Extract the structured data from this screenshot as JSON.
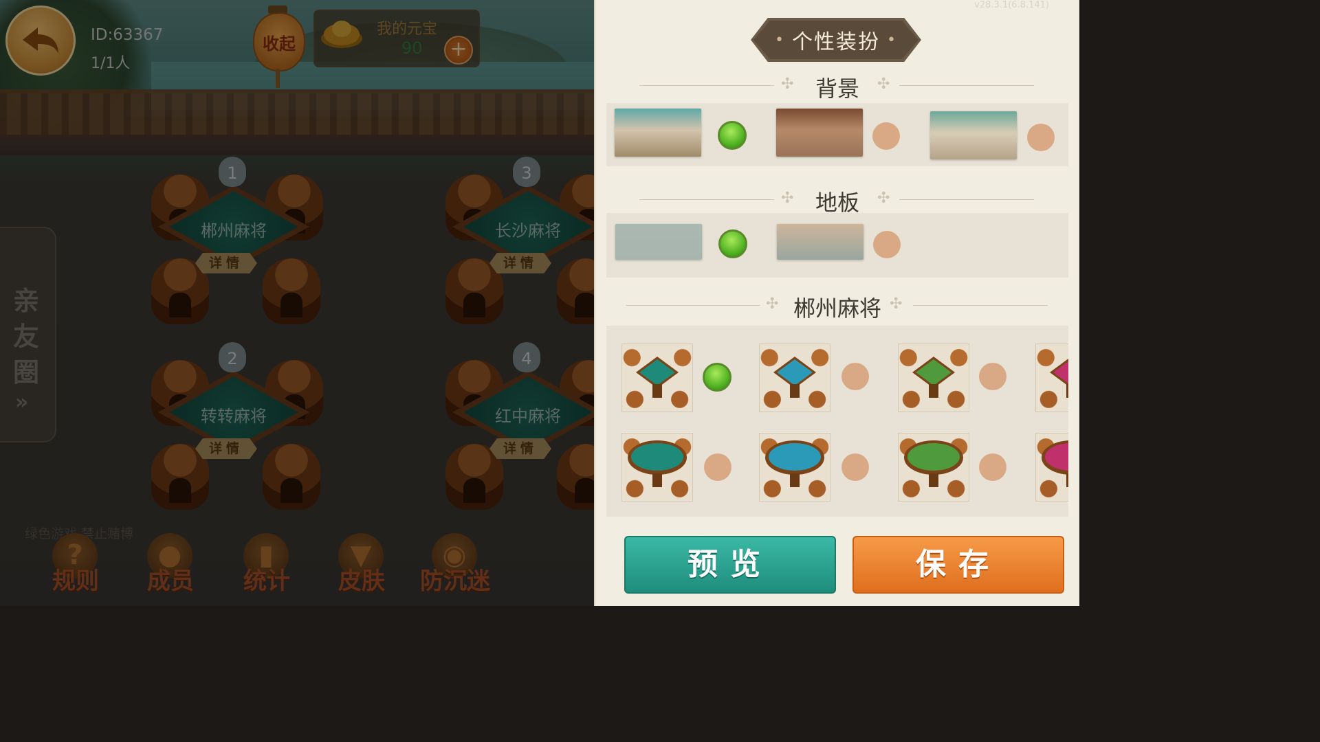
{
  "header": {
    "room_id": "ID:63367",
    "player_count": "1/1人",
    "collapse_label": "收起",
    "ingot_title": "我的元宝",
    "ingot_value": "90",
    "add_symbol": "+"
  },
  "friends_tab": {
    "label": "亲友圈",
    "arrow": "»"
  },
  "tables": [
    {
      "number": "1",
      "name": "郴州麻将",
      "detail": "详情"
    },
    {
      "number": "3",
      "name": "长沙麻将",
      "detail": "详情"
    },
    {
      "number": "2",
      "name": "转转麻将",
      "detail": "详情"
    },
    {
      "number": "4",
      "name": "红中麻将",
      "detail": "详情"
    }
  ],
  "notice": "绿色游戏  禁止赌博",
  "bottom_nav": [
    {
      "label": "规则",
      "icon": "question-icon"
    },
    {
      "label": "成员",
      "icon": "person-icon"
    },
    {
      "label": "统计",
      "icon": "bar-chart-icon"
    },
    {
      "label": "皮肤",
      "icon": "shirt-icon"
    },
    {
      "label": "防沉迷",
      "icon": "mask-icon"
    }
  ],
  "panel": {
    "version": "v28.3.1(6.8.141)",
    "title": "个性装扮",
    "sections": {
      "background": {
        "label": "背景",
        "options": [
          {
            "selected": true,
            "colors": [
              "#5ea8a6",
              "#d4c4ac",
              "#a08a6a"
            ]
          },
          {
            "selected": false,
            "colors": [
              "#7a4a30",
              "#b58a6a",
              "#9a7258"
            ]
          },
          {
            "selected": false,
            "colors": [
              "#6ea89a",
              "#d8ccb6",
              "#b4a488"
            ]
          }
        ]
      },
      "floor": {
        "label": "地板",
        "options": [
          {
            "selected": true,
            "colors": [
              "#aab8b2",
              "#a8b5ae"
            ]
          },
          {
            "selected": false,
            "colors": [
              "#cdb59a",
              "#9aa6a0"
            ]
          }
        ]
      },
      "table_style": {
        "label": "郴州麻将",
        "square": [
          {
            "selected": true,
            "felt": "#1e8a7a"
          },
          {
            "selected": false,
            "felt": "#2a9ab8"
          },
          {
            "selected": false,
            "felt": "#4f9a3c"
          },
          {
            "selected": false,
            "felt": "#c0306a"
          }
        ],
        "round": [
          {
            "selected": false,
            "felt": "#1e8a7a"
          },
          {
            "selected": false,
            "felt": "#2a9ab8"
          },
          {
            "selected": false,
            "felt": "#4f9a3c"
          },
          {
            "selected": false,
            "felt": "#c0306a"
          }
        ]
      }
    },
    "preview_label": "预览",
    "save_label": "保存"
  }
}
